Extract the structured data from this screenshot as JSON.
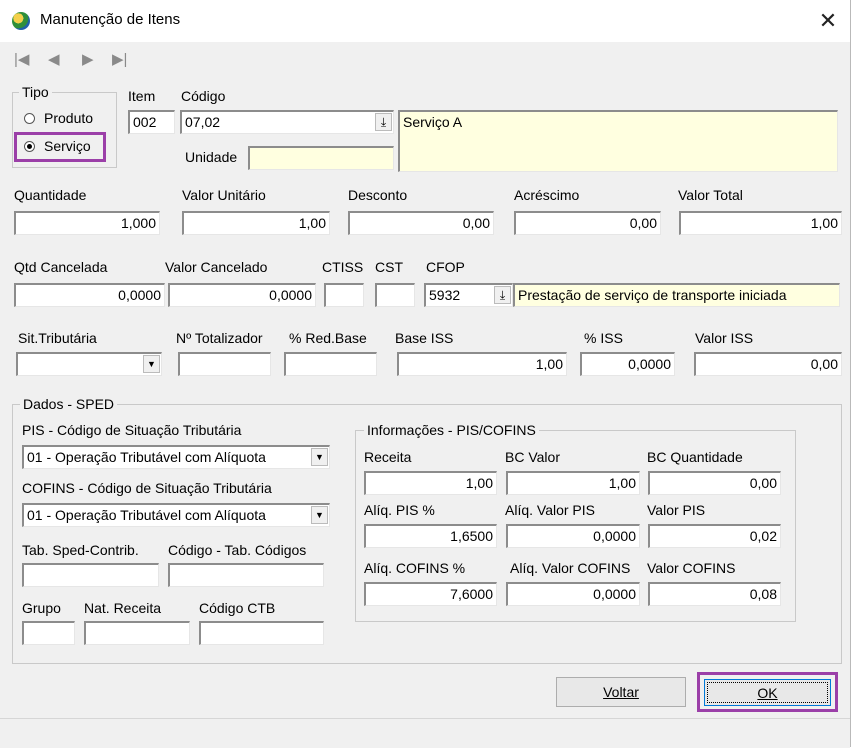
{
  "window": {
    "title": "Manutenção de Itens",
    "close_glyph": "✕"
  },
  "nav": {
    "first": "|◀",
    "prev": "◀",
    "next": "▶",
    "last": "▶|"
  },
  "tipo": {
    "label": "Tipo",
    "produto": "Produto",
    "servico": "Serviço",
    "selected": "Serviço"
  },
  "item": {
    "label": "Item",
    "value": "002"
  },
  "codigo": {
    "label": "Código",
    "value": "07,02",
    "description": "Serviço A"
  },
  "unidade": {
    "label": "Unidade",
    "value": ""
  },
  "row1": {
    "quantidade": {
      "label": "Quantidade",
      "value": "1,000"
    },
    "valor_unitario": {
      "label": "Valor Unitário",
      "value": "1,00"
    },
    "desconto": {
      "label": "Desconto",
      "value": "0,00"
    },
    "acrescimo": {
      "label": "Acréscimo",
      "value": "0,00"
    },
    "valor_total": {
      "label": "Valor Total",
      "value": "1,00"
    }
  },
  "row2": {
    "qtd_cancelada": {
      "label": "Qtd Cancelada",
      "value": "0,0000"
    },
    "valor_cancelado": {
      "label": "Valor Cancelado",
      "value": "0,0000"
    },
    "ctiss": {
      "label": "CTISS",
      "value": ""
    },
    "cst": {
      "label": "CST",
      "value": ""
    },
    "cfop": {
      "label": "CFOP",
      "value": "5932",
      "description": "Prestação de serviço de transporte iniciada"
    }
  },
  "row3": {
    "sit_tributaria": {
      "label": "Sit.Tributária",
      "value": ""
    },
    "num_totalizador": {
      "label": "Nº Totalizador",
      "value": ""
    },
    "red_base": {
      "label": "% Red.Base",
      "value": ""
    },
    "base_iss": {
      "label": "Base ISS",
      "value": "1,00"
    },
    "pct_iss": {
      "label": "% ISS",
      "value": "0,0000"
    },
    "valor_iss": {
      "label": "Valor ISS",
      "value": "0,00"
    }
  },
  "sped": {
    "title": "Dados - SPED",
    "pis_label": "PIS -  Código de Situação Tributária",
    "pis_value": "01 - Operação Tributável com Alíquota",
    "cofins_label": "COFINS -  Código de Situação Tributária",
    "cofins_value": "01 - Operação Tributável com Alíquota",
    "tab_sped_label": "Tab. Sped-Contrib.",
    "tab_codigos_label": "Código - Tab. Códigos",
    "grupo_label": "Grupo",
    "nat_receita_label": "Nat. Receita",
    "codigo_ctb_label": "Código CTB"
  },
  "pis_cofins": {
    "title": "Informações - PIS/COFINS",
    "receita": {
      "label": "Receita",
      "value": "1,00"
    },
    "bc_valor": {
      "label": "BC Valor",
      "value": "1,00"
    },
    "bc_quantidade": {
      "label": "BC Quantidade",
      "value": "0,00"
    },
    "aliq_pis": {
      "label": "Alíq. PIS %",
      "value": "1,6500"
    },
    "aliq_valor_pis": {
      "label": "Alíq. Valor PIS",
      "value": "0,0000"
    },
    "valor_pis": {
      "label": "Valor PIS",
      "value": "0,02"
    },
    "aliq_cofins": {
      "label": "Alíq. COFINS %",
      "value": "7,6000"
    },
    "aliq_valor_cofins": {
      "label": "Alíq. Valor COFINS",
      "value": "0,0000"
    },
    "valor_cofins": {
      "label": "Valor COFINS",
      "value": "0,08"
    }
  },
  "buttons": {
    "voltar": "Voltar",
    "ok": "OK"
  },
  "colors": {
    "highlight": "#9b3fa8",
    "yellow_field": "#ffffe0"
  }
}
